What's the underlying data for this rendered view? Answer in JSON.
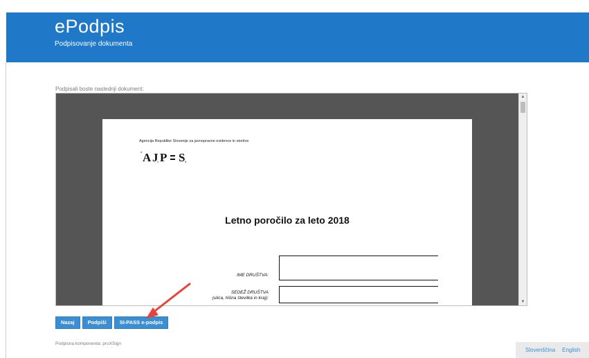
{
  "header": {
    "app_title": "ePodpis",
    "subtitle": "Podpisovanje dokumenta"
  },
  "main": {
    "doc_label": "Podpisali boste naslednji dokument:",
    "document": {
      "agency": "Agencija Republike Slovenije za javnopravne evidence in storitve",
      "title": "Letno poročilo za leto 2018",
      "field1_label": "IME DRUŠTVA:",
      "field2_label_line1": "SEDEŽ DRUŠTVA",
      "field2_label_line2": "(ulica, hišna številka in kraj):"
    }
  },
  "actions": {
    "back_label": "Nazaj",
    "sign_label": "Podpiši",
    "sipass_label": "SI-PASS e-podpis"
  },
  "footer": {
    "component_note": "Podpisna komponenta: proXSign",
    "lang_sl": "Slovenščina",
    "lang_en": "English"
  },
  "colors": {
    "header_bg": "#1f78c8",
    "button_bg": "#3b8ed3",
    "viewer_bg": "#555555",
    "annotation_arrow": "#e8433a"
  },
  "icons": {
    "scroll_up": "▲",
    "scroll_down": "▼"
  }
}
